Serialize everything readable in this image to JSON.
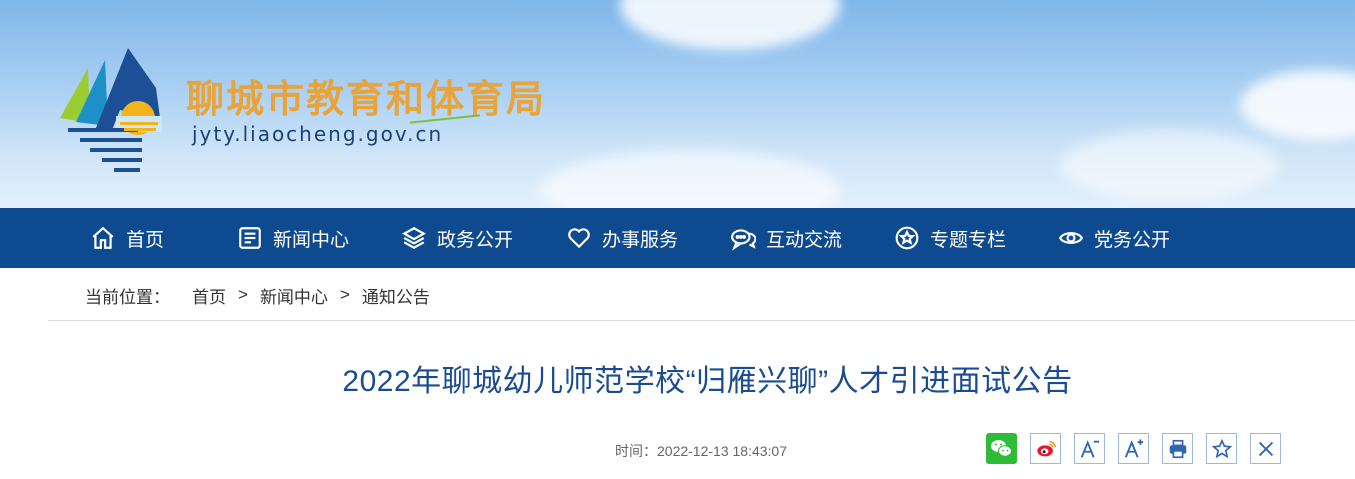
{
  "header": {
    "site_title": "聊城市教育和体育局",
    "site_url": "jyty.liaocheng.gov.cn"
  },
  "nav": {
    "items": [
      {
        "label": "首页",
        "icon": "home-icon"
      },
      {
        "label": "新闻中心",
        "icon": "news-icon"
      },
      {
        "label": "政务公开",
        "icon": "layers-icon"
      },
      {
        "label": "办事服务",
        "icon": "heart-icon"
      },
      {
        "label": "互动交流",
        "icon": "chat-icon"
      },
      {
        "label": "专题专栏",
        "icon": "star-circle-icon"
      },
      {
        "label": "党务公开",
        "icon": "eye-icon"
      }
    ]
  },
  "breadcrumb": {
    "prefix": "当前位置：",
    "items": [
      "首页",
      "新闻中心",
      "通知公告"
    ],
    "separator": ">"
  },
  "article": {
    "title": "2022年聊城幼儿师范学校“归雁兴聊”人才引进面试公告",
    "time_label": "时间：",
    "time_value": "2022-12-13 18:43:07"
  },
  "tools": [
    "wechat-share-icon",
    "weibo-share-icon",
    "font-decrease-icon",
    "font-increase-icon",
    "print-icon",
    "favorite-icon",
    "close-icon"
  ],
  "colors": {
    "nav_bg": "#0e4a8f",
    "title_color": "#1b4c93",
    "site_title_color": "#e8a33a",
    "wechat_green": "#2dbb38",
    "weibo_red": "#e6162d"
  }
}
